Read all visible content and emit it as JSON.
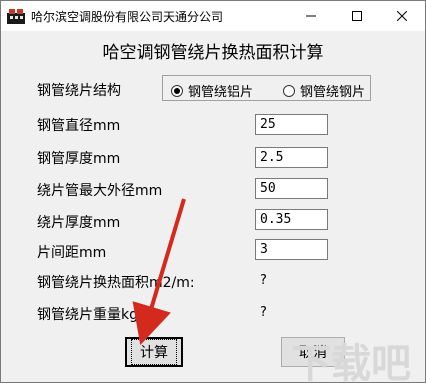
{
  "window": {
    "title": "哈尔滨空调股份有限公司天通分公司",
    "controls": {
      "minimize": "—",
      "maximize": "☐",
      "close": "✕"
    }
  },
  "heading": "哈空调钢管绕片换热面积计算",
  "structure": {
    "label": "钢管绕片结构",
    "options": [
      "钢管绕铝片",
      "钢管绕钢片"
    ],
    "selected": "钢管绕铝片"
  },
  "fields": [
    {
      "label": "钢管直径mm",
      "value": "25"
    },
    {
      "label": "钢管厚度mm",
      "value": "2.5"
    },
    {
      "label": "绕片管最大外径mm",
      "value": "50"
    },
    {
      "label": "绕片厚度mm",
      "value": "0.35"
    },
    {
      "label": "片间距mm",
      "value": "3"
    }
  ],
  "results": [
    {
      "label": "钢管绕片换热面积m2/m:",
      "value": "?"
    },
    {
      "label": "钢管绕片重量kg/m:",
      "value": "?"
    }
  ],
  "buttons": {
    "calculate": "计算",
    "cancel": "取消"
  },
  "watermark": "下载吧"
}
